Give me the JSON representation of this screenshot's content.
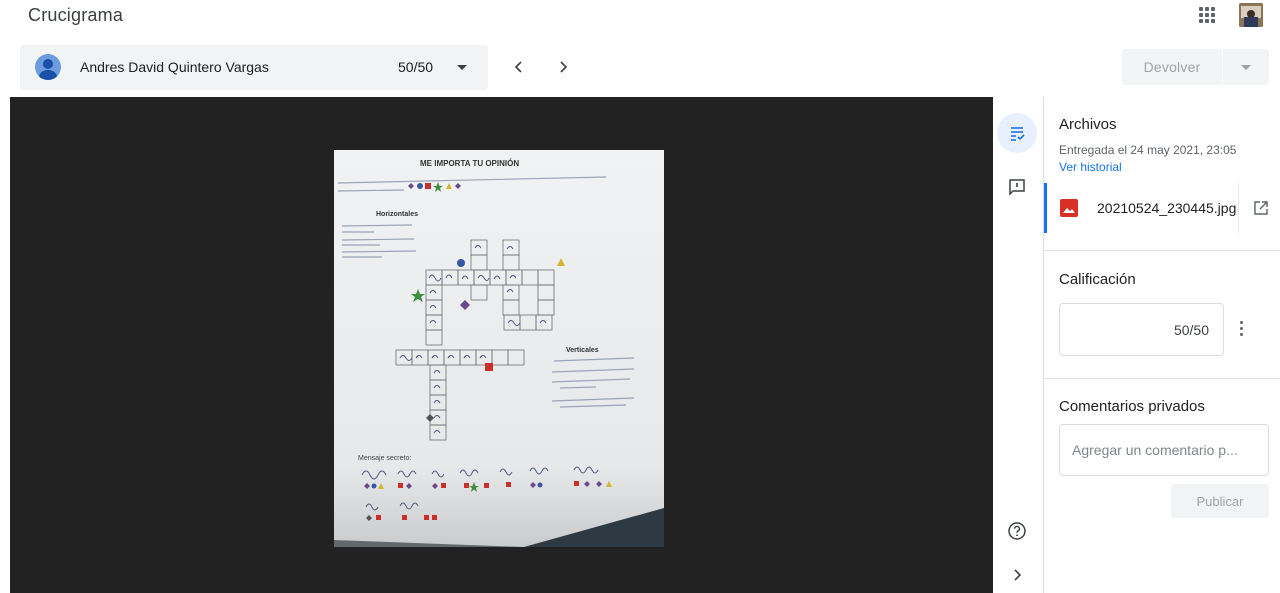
{
  "app": {
    "title": "Crucigrama"
  },
  "student": {
    "name": "Andres David Quintero Vargas",
    "score": "50/50"
  },
  "actions": {
    "return_label": "Devolver"
  },
  "document": {
    "heading": "ME IMPORTA TU OPINIÓN",
    "instructions": "Lee atentamente las descripciones, resuelve el crucigrama y descubre el mensaje oculto a partir de las formas",
    "horizontal_title": "Horizontales",
    "vertical_title": "Verticales",
    "secret_label": "Mensaje secreto:"
  },
  "panel": {
    "files_heading": "Archivos",
    "submitted": "Entregada el 24 may 2021, 23:05",
    "history_link": "Ver historial",
    "file_name": "20210524_230445.jpg",
    "grade_heading": "Calificación",
    "grade_value": "50/50",
    "comments_heading": "Comentarios privados",
    "comment_placeholder": "Agregar un comentario p...",
    "publish_label": "Publicar"
  },
  "colors": {
    "accent": "#1a73e8",
    "file_icon": "#d93025",
    "viewer_bg": "#222222"
  },
  "icons": [
    "apps-icon",
    "account-avatar",
    "chevron-left-icon",
    "chevron-right-icon",
    "dropdown-arrow-icon",
    "files-icon",
    "comment-icon",
    "help-icon",
    "expand-right-icon",
    "image-file-icon",
    "open-in-new-icon",
    "more-vert-icon"
  ]
}
